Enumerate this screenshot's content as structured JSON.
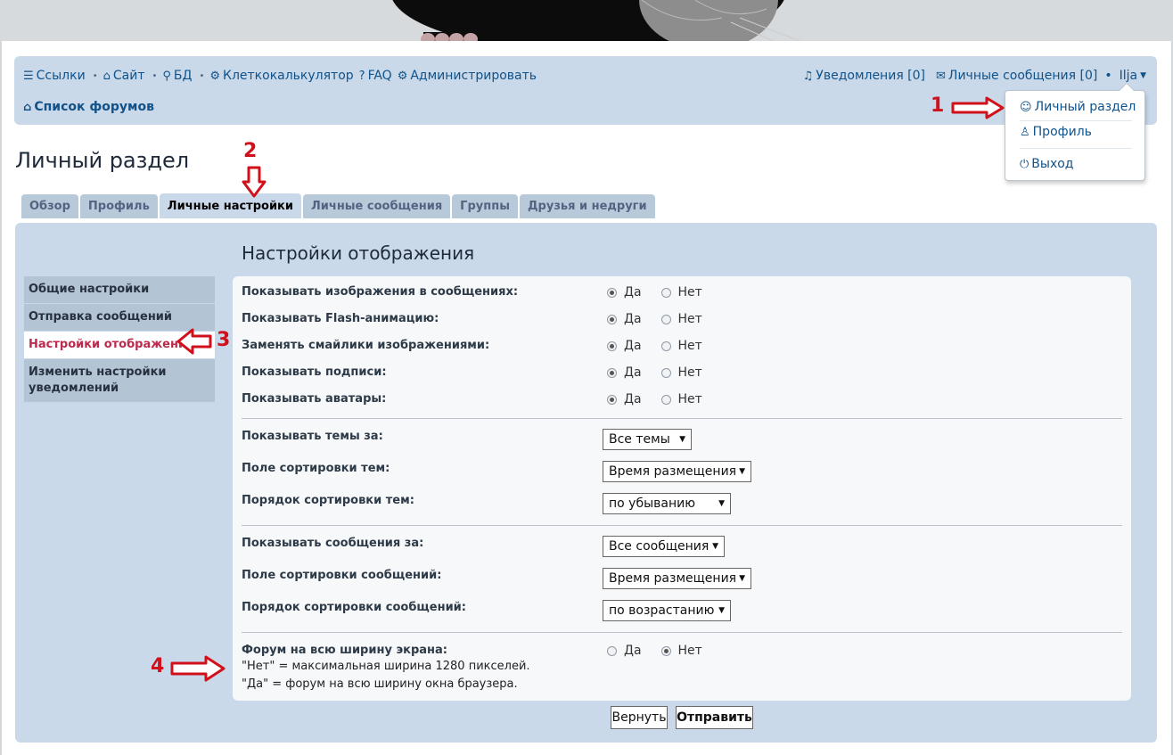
{
  "nav": {
    "links_label": "Ссылки",
    "site_label": "Сайт",
    "db_label": "БД",
    "calc_label": "Клеткокалькулятор",
    "faq_label": "FAQ",
    "admin_label": "Администрировать",
    "notifications_label": "Уведомления [0]",
    "pm_label": "Личные сообщения [0]",
    "user_label": "Ilja",
    "breadcrumb": "Список форумов"
  },
  "dropdown": {
    "items": [
      "Личный раздел",
      "Профиль",
      "Выход"
    ]
  },
  "page_title": "Личный раздел",
  "tabs": [
    "Обзор",
    "Профиль",
    "Личные настройки",
    "Личные сообщения",
    "Группы",
    "Друзья и недруги"
  ],
  "active_tab": "Личные настройки",
  "section_title": "Настройки отображения",
  "side_menu": [
    "Общие настройки",
    "Отправка сообщений",
    "Настройки отображения",
    "Изменить настройки уведомлений"
  ],
  "active_side_item": "Настройки отображения",
  "yes_label": "Да",
  "no_label": "Нет",
  "radio_settings": [
    {
      "label": "Показывать изображения в сообщениях:",
      "value": "Да"
    },
    {
      "label": "Показывать Flash-анимацию:",
      "value": "Да"
    },
    {
      "label": "Заменять смайлики изображениями:",
      "value": "Да"
    },
    {
      "label": "Показывать подписи:",
      "value": "Да"
    },
    {
      "label": "Показывать аватары:",
      "value": "Да"
    }
  ],
  "topic_settings": [
    {
      "label": "Показывать темы за:",
      "value": "Все темы"
    },
    {
      "label": "Поле сортировки тем:",
      "value": "Время размещения"
    },
    {
      "label": "Порядок сортировки тем:",
      "value": "по убыванию"
    }
  ],
  "post_settings": [
    {
      "label": "Показывать сообщения за:",
      "value": "Все сообщения"
    },
    {
      "label": "Поле сортировки сообщений:",
      "value": "Время размещения"
    },
    {
      "label": "Порядок сортировки сообщений:",
      "value": "по возрастанию"
    }
  ],
  "fullwidth": {
    "label": "Форум на всю ширину экрана:",
    "value": "Нет",
    "note1": "\"Нет\" = максимальная ширина 1280 пикселей.",
    "note2": "\"Да\" = форум на всю ширину окна браузера."
  },
  "buttons": {
    "reset": "Вернуть",
    "submit": "Отправить"
  },
  "annotations": [
    "1",
    "2",
    "3",
    "4"
  ],
  "annotation_color": "#d0101a",
  "link_color": "#105289",
  "panel_color": "#c9d9ea"
}
